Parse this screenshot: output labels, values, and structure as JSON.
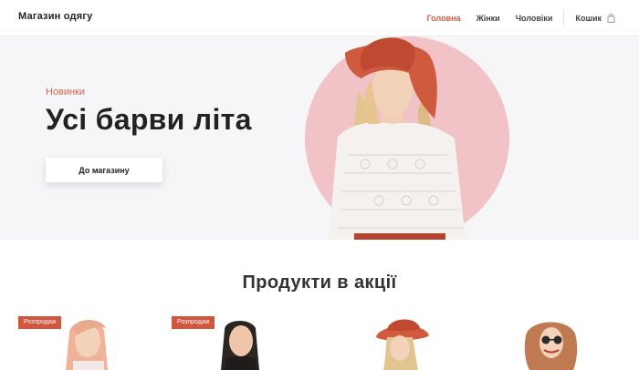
{
  "header": {
    "brand": "Магазин одягу",
    "nav": [
      {
        "label": "Головна",
        "active": true
      },
      {
        "label": "Жінки",
        "active": false
      },
      {
        "label": "Чоловіки",
        "active": false
      }
    ],
    "cart_label": "Кошик",
    "cart_icon": "shopping-bag-icon"
  },
  "hero": {
    "eyebrow": "Новинки",
    "title": "Усі барви літа",
    "button_label": "До магазину",
    "accent_color": "#d2674f",
    "circle_color": "#f1c3c6"
  },
  "products": {
    "heading": "Продукти в акції",
    "items": [
      {
        "badge": "Розпродаж"
      },
      {
        "badge": "Розпродаж"
      },
      {
        "badge": ""
      },
      {
        "badge": ""
      }
    ]
  }
}
